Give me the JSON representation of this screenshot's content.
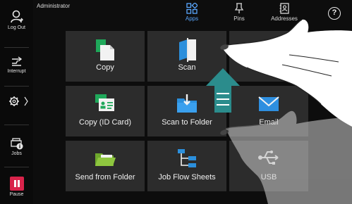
{
  "header": {
    "user": "Administrator"
  },
  "rail": {
    "logout": "Log Out",
    "interrupt": "Interrupt",
    "jobs": "Jobs",
    "pause": "Pause"
  },
  "tabs": [
    {
      "label": "Apps",
      "icon": "apps-grid-icon",
      "active": true
    },
    {
      "label": "Pins",
      "icon": "pin-icon",
      "active": false
    },
    {
      "label": "Addresses",
      "icon": "address-book-icon",
      "active": false
    }
  ],
  "help_glyph": "?",
  "tiles": [
    {
      "label": "Copy",
      "icon": "copy-icon"
    },
    {
      "label": "Scan",
      "icon": "scan-icon"
    },
    {
      "label": "",
      "icon": "fax-icon"
    },
    {
      "label": "Copy (ID Card)",
      "icon": "id-card-copy-icon"
    },
    {
      "label": "Scan to Folder",
      "icon": "scan-to-folder-icon"
    },
    {
      "label": "Email",
      "icon": "email-icon"
    },
    {
      "label": "Send from Folder",
      "icon": "send-from-folder-icon"
    },
    {
      "label": "Job Flow Sheets",
      "icon": "job-flow-sheets-icon"
    },
    {
      "label": "USB",
      "icon": "usb-icon"
    }
  ],
  "colors": {
    "accent": "#5aa7ff",
    "tile_bg": "#2c2c2c",
    "copy_green": "#1fa85a",
    "scan_blue": "#2b8fdc",
    "fax_purple": "#8d3dd6",
    "email_blue": "#2e8fe0",
    "folder_green": "#8ec63f",
    "pause_red": "#d8234a",
    "arrow_teal": "#2b8c8c"
  }
}
